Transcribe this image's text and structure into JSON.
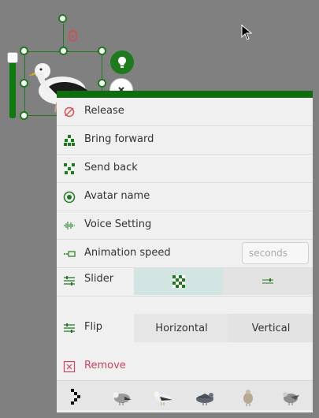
{
  "menu": {
    "release": "Release",
    "bring_forward": "Bring forward",
    "send_back": "Send back",
    "avatar_name": "Avatar name",
    "voice_setting": "Voice Setting",
    "animation_speed": "Animation speed",
    "speed_placeholder": "seconds",
    "slider": "Slider",
    "flip": "Flip",
    "flip_horizontal": "Horizontal",
    "flip_vertical": "Vertical",
    "remove": "Remove"
  },
  "colors": {
    "accent_green": "#1d7a1d",
    "remove_red": "#d0435e",
    "slider_selected": "#d3e5e3"
  },
  "icons": {
    "release": "release-icon",
    "bring_forward": "bring-forward-icon",
    "send_back": "send-back-icon",
    "avatar_name": "avatar-icon",
    "voice_setting": "voice-wave-icon",
    "animation_speed": "speed-icon",
    "slider": "slider-icon",
    "flip": "flip-icon",
    "remove": "remove-icon"
  },
  "avatars": [
    "seagull-standing",
    "seagull-walking-left",
    "seagull-walking-right",
    "seagull-gray",
    "seagull-small",
    "seagull-side"
  ]
}
